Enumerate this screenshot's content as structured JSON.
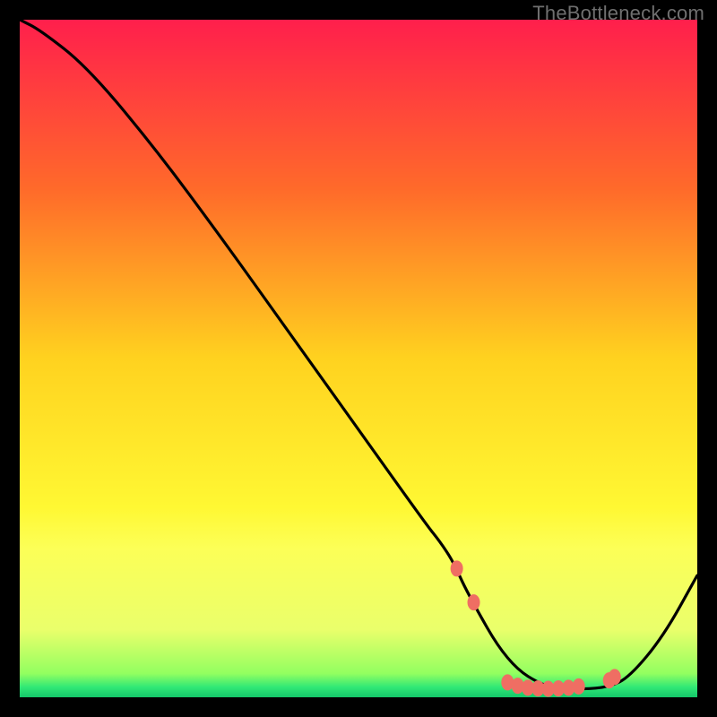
{
  "watermark": "TheBottleneck.com",
  "chart_data": {
    "type": "line",
    "title": "",
    "xlabel": "",
    "ylabel": "",
    "xlim": [
      0,
      100
    ],
    "ylim": [
      0,
      100
    ],
    "grid": false,
    "legend": "none",
    "series": [
      {
        "name": "curve",
        "x": [
          0,
          3,
          10,
          20,
          30,
          40,
          50,
          60,
          62,
          64,
          66,
          72,
          78,
          83,
          87,
          90,
          95,
          100
        ],
        "y": [
          100,
          98.5,
          93,
          81,
          67.5,
          53.5,
          39.5,
          25.5,
          23,
          20,
          15.5,
          5,
          1.2,
          1.2,
          1.5,
          3,
          9,
          18
        ]
      }
    ],
    "markers": {
      "name": "highlight-points",
      "x": [
        64.5,
        67,
        72,
        73.5,
        75,
        76.5,
        78,
        79.5,
        81,
        82.5,
        87,
        87.8
      ],
      "y": [
        19,
        14,
        2.2,
        1.7,
        1.4,
        1.3,
        1.25,
        1.3,
        1.4,
        1.6,
        2.5,
        3.0
      ]
    },
    "background_gradient": {
      "stops": [
        {
          "pos": 0.0,
          "color": "#ff1f4c"
        },
        {
          "pos": 0.25,
          "color": "#ff6a2a"
        },
        {
          "pos": 0.5,
          "color": "#ffd21f"
        },
        {
          "pos": 0.72,
          "color": "#fff833"
        },
        {
          "pos": 0.78,
          "color": "#fcff57"
        },
        {
          "pos": 0.9,
          "color": "#eaff6b"
        },
        {
          "pos": 0.965,
          "color": "#92ff60"
        },
        {
          "pos": 0.985,
          "color": "#30e876"
        },
        {
          "pos": 1.0,
          "color": "#14c76a"
        }
      ]
    }
  }
}
